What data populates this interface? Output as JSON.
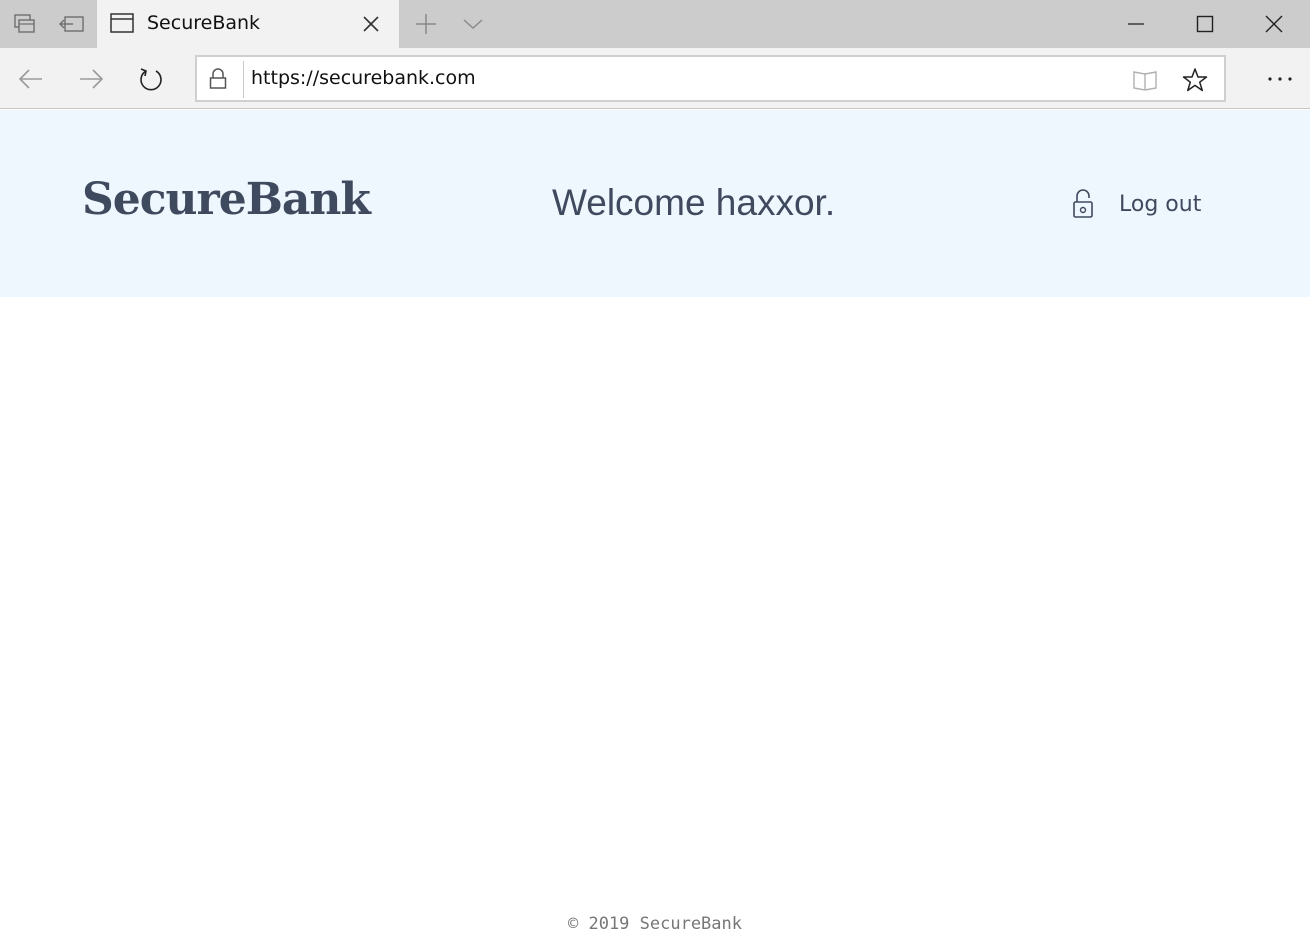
{
  "browser": {
    "tab": {
      "title": "SecureBank"
    },
    "address_bar": {
      "url": "https://securebank.com"
    },
    "icons": {
      "tab_preview": "tab-preview-icon",
      "set_aside": "set-aside-tabs-icon",
      "new_tab": "plus-icon",
      "tab_list": "chevron-down-icon",
      "minimize": "minimize-icon",
      "maximize": "maximize-icon",
      "close": "close-icon",
      "back": "arrow-left-icon",
      "forward": "arrow-right-icon",
      "refresh": "refresh-icon",
      "lock": "lock-icon",
      "reading_view": "book-icon",
      "favorite": "star-icon",
      "more": "ellipsis-icon"
    }
  },
  "site": {
    "logo": "SecureBank",
    "welcome": "Welcome haxxor.",
    "logout_label": "Log out",
    "footer": "© 2019 SecureBank",
    "colors": {
      "header_bg": "#eef6fe",
      "text": "#3f4a5e",
      "footer_text": "#777777"
    }
  }
}
